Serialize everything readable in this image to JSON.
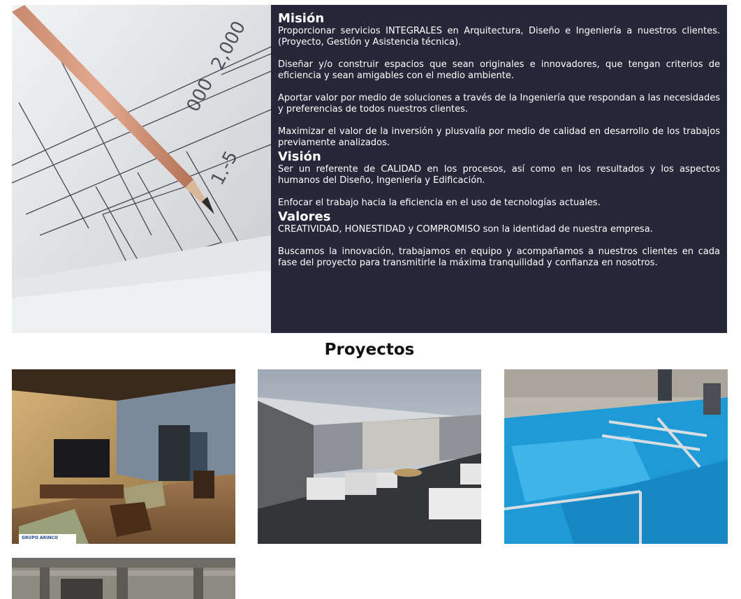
{
  "about": {
    "image_alt": "Lápiz sobre planos de arquitectura",
    "mision": {
      "title": "Misión",
      "paragraphs": [
        "Proporcionar servicios INTEGRALES en Arquitectura, Diseño e Ingeniería a nuestros clientes. (Proyecto, Gestión y Asistencia técnica).",
        "Diseñar y/o construir espacios que sean originales e innovadores, que tengan criterios de eficiencia y sean amigables con el medio ambiente.",
        "Aportar valor por medio de soluciones a través de la Ingeniería que respondan a las necesidades y preferencias de todos nuestros clientes.",
        "Maximizar el valor de la inversión y plusvalía por medio de calidad en desarrollo de los trabajos previamente analizados."
      ]
    },
    "vision": {
      "title": "Visión",
      "paragraphs": [
        "Ser un referente de CALIDAD en los procesos, así como en los resultados y los aspectos humanos del Diseño, Ingeniería y Edificación.",
        "Enfocar el trabajo hacia la eficiencia en el uso de tecnologías actuales."
      ]
    },
    "valores": {
      "title": "Valores",
      "paragraphs": [
        "CREATIVIDAD, HONESTIDAD y COMPROMISO son la identidad de nuestra empresa.",
        "Buscamos la innovación, trabajamos en equipo y acompañamos a nuestros clientes en cada fase del proyecto para transmitirle la máxima tranquilidad y confianza en nosotros."
      ]
    }
  },
  "projects": {
    "title": "Proyectos",
    "items": [
      {
        "image": "living-room-render",
        "logo_text": "GRUPO ARINCO"
      },
      {
        "image": "warehouse-render"
      },
      {
        "image": "pool-construction-photo"
      },
      {
        "image": "concrete-structure-photo"
      }
    ]
  },
  "colors": {
    "about_panel_bg": "#262839",
    "about_text": "#ffffff",
    "heading_text": "#111111"
  }
}
